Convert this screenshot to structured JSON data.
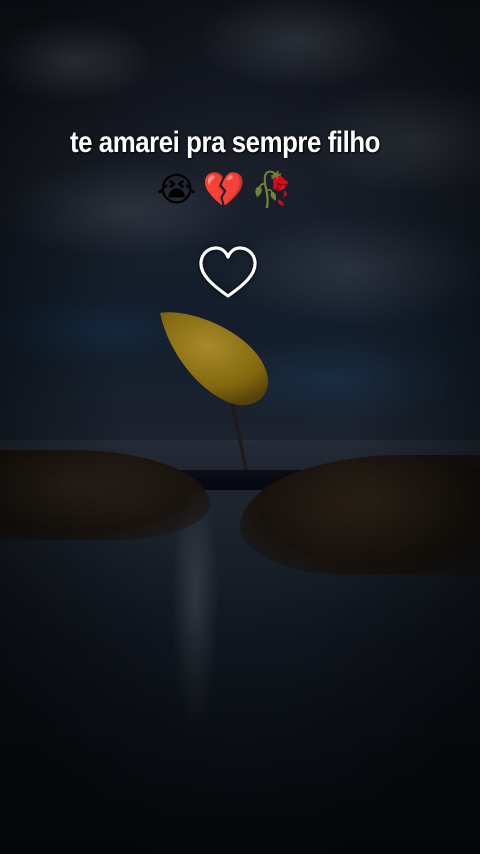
{
  "caption": {
    "text": "te amarei pra sempre filho",
    "emojis": [
      "😭",
      "💔",
      "🥀"
    ]
  },
  "icons": {
    "heart": "heart-outline-icon"
  },
  "colors": {
    "caption_text": "#ffffff",
    "balloon": "#d4a91b",
    "heart": "#ffffff"
  }
}
